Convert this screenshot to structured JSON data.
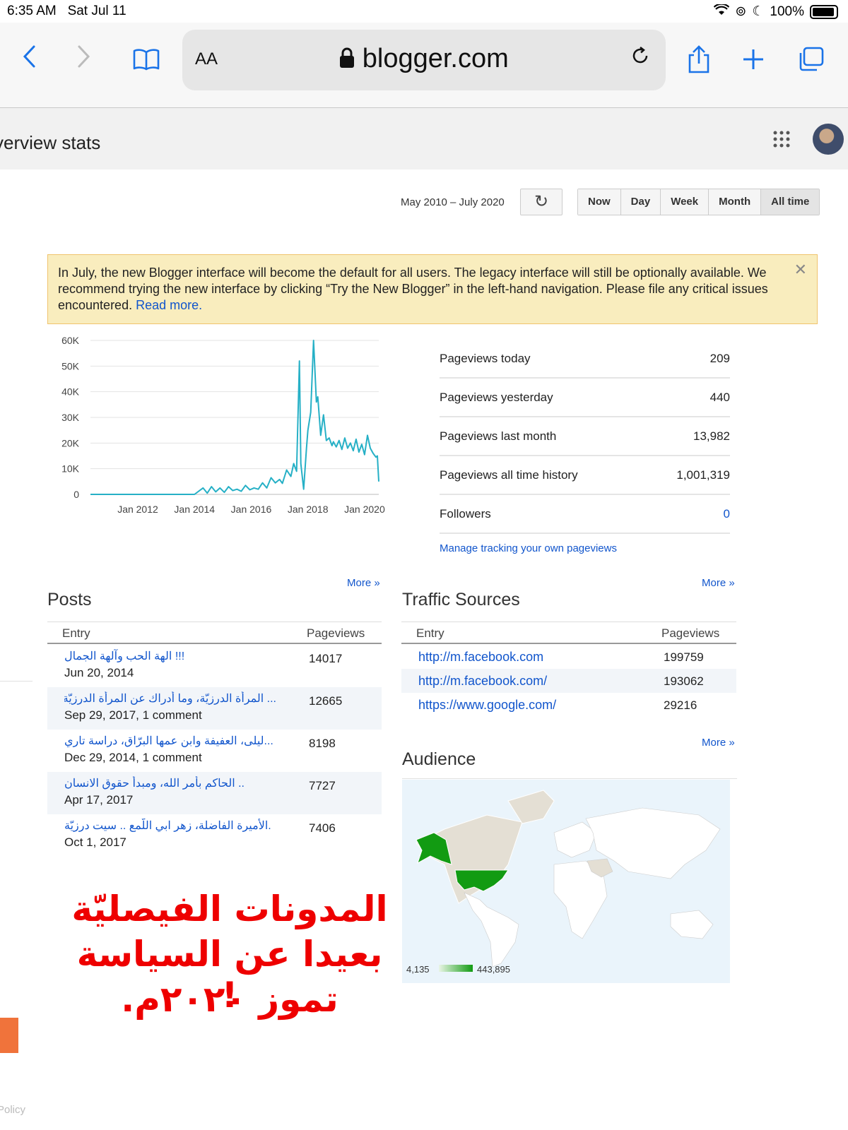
{
  "status_bar": {
    "time": "6:35 AM",
    "date": "Sat Jul 11",
    "battery": "100%"
  },
  "browser": {
    "text_size_label": "AA",
    "url": "blogger.com"
  },
  "page": {
    "title": "verview stats"
  },
  "date_range": {
    "label": "May 2010 – July 2020",
    "buttons": [
      "Now",
      "Day",
      "Week",
      "Month",
      "All time"
    ],
    "selected": "All time"
  },
  "notice": {
    "text": "In July, the new Blogger interface will become the default for all users. The legacy interface will still be optionally available. We recommend trying the new interface by clicking “Try the New Blogger” in the left-hand navigation. Please file any critical issues encountered.",
    "link": "Read more."
  },
  "chart_data": {
    "type": "line",
    "title": "",
    "xlabel": "",
    "ylabel": "",
    "x_ticks": [
      "Jan 2012",
      "Jan 2014",
      "Jan 2016",
      "Jan 2018",
      "Jan 2020"
    ],
    "y_ticks": [
      "60K",
      "50K",
      "40K",
      "30K",
      "20K",
      "10K",
      "0"
    ],
    "ylim": [
      0,
      60000
    ],
    "xlim": [
      2010.33,
      2020.5
    ],
    "grid": true,
    "color": "#26b0c6",
    "series": [
      {
        "x": [
          2010.33,
          2013.0,
          2014.0,
          2014.3,
          2014.45,
          2014.6,
          2014.75,
          2014.9,
          2015.05,
          2015.2,
          2015.35,
          2015.5,
          2015.65,
          2015.8,
          2015.95,
          2016.1,
          2016.25,
          2016.4,
          2016.55,
          2016.7,
          2016.85,
          2017.0,
          2017.1,
          2017.25,
          2017.4,
          2017.5,
          2017.6,
          2017.7,
          2017.75,
          2017.85,
          2017.95,
          2018.0,
          2018.1,
          2018.2,
          2018.3,
          2018.35,
          2018.45,
          2018.55,
          2018.65,
          2018.75,
          2018.85,
          2018.9,
          2019.0,
          2019.1,
          2019.2,
          2019.3,
          2019.4,
          2019.5,
          2019.6,
          2019.7,
          2019.8,
          2019.9,
          2020.0,
          2020.1,
          2020.2,
          2020.3,
          2020.4,
          2020.45,
          2020.5
        ],
        "y": [
          0,
          0,
          0,
          2500,
          500,
          3000,
          1000,
          2500,
          800,
          3000,
          1500,
          2000,
          1200,
          3500,
          1800,
          2500,
          2000,
          4500,
          2500,
          6500,
          4500,
          5800,
          4300,
          9500,
          7000,
          12000,
          9000,
          52000,
          12000,
          2000,
          18000,
          25000,
          32000,
          60000,
          36000,
          38000,
          23000,
          31000,
          21000,
          22000,
          19000,
          20500,
          18500,
          21000,
          17500,
          22000,
          18000,
          20000,
          17000,
          21500,
          16500,
          19500,
          15500,
          23000,
          18000,
          16000,
          14500,
          15000,
          5000
        ]
      }
    ]
  },
  "stats": [
    {
      "label": "Pageviews today",
      "value": "209"
    },
    {
      "label": "Pageviews yesterday",
      "value": "440"
    },
    {
      "label": "Pageviews last month",
      "value": "13,982"
    },
    {
      "label": "Pageviews all time history",
      "value": "1,001,319"
    },
    {
      "label": "Followers",
      "value": "0"
    }
  ],
  "manage_link": "Manage tracking your own pageviews",
  "posts": {
    "title": "Posts",
    "more": "More »",
    "col_entry": "Entry",
    "col_views": "Pageviews",
    "rows": [
      {
        "title": "!!! الهة الحب وآلهة الجمال",
        "meta": "Jun 20, 2014",
        "views": "14017"
      },
      {
        "title": "... المرأة الدرزيّة، وما أدراك عن المرأة الدرزيّة",
        "meta": "Sep 29, 2017, 1 comment",
        "views": "12665"
      },
      {
        "title": "...ليلى، العفيفة وابن عمها البرّاق، دراسة تاري",
        "meta": "Dec 29, 2014, 1 comment",
        "views": "8198"
      },
      {
        "title": ".. الحاكم بأمر الله، ومبدأ حقوق الانسان",
        "meta": "Apr 17, 2017",
        "views": "7727"
      },
      {
        "title": ".الأميرة الفاضلة، زهر ابي اللّمع .. سيت درزيّة",
        "meta": "Oct 1, 2017",
        "views": "7406"
      }
    ]
  },
  "traffic": {
    "title": "Traffic Sources",
    "more": "More »",
    "col_entry": "Entry",
    "col_views": "Pageviews",
    "rows": [
      {
        "url": "http://m.facebook.com",
        "views": "199759"
      },
      {
        "url": "http://m.facebook.com/",
        "views": "193062"
      },
      {
        "url": "https://www.google.com/",
        "views": "29216"
      }
    ]
  },
  "audience": {
    "title": "Audience",
    "more": "More »",
    "legend_min": "4,135",
    "legend_max": "443,895",
    "highlight_color": "#129b12"
  },
  "overlay": {
    "line1": "المدونات الفيصليّة",
    "line2": "بعيدا عن السياسة !",
    "line3": "تموز ٢٠٢٠م."
  },
  "footer": {
    "policy": "Policy"
  }
}
